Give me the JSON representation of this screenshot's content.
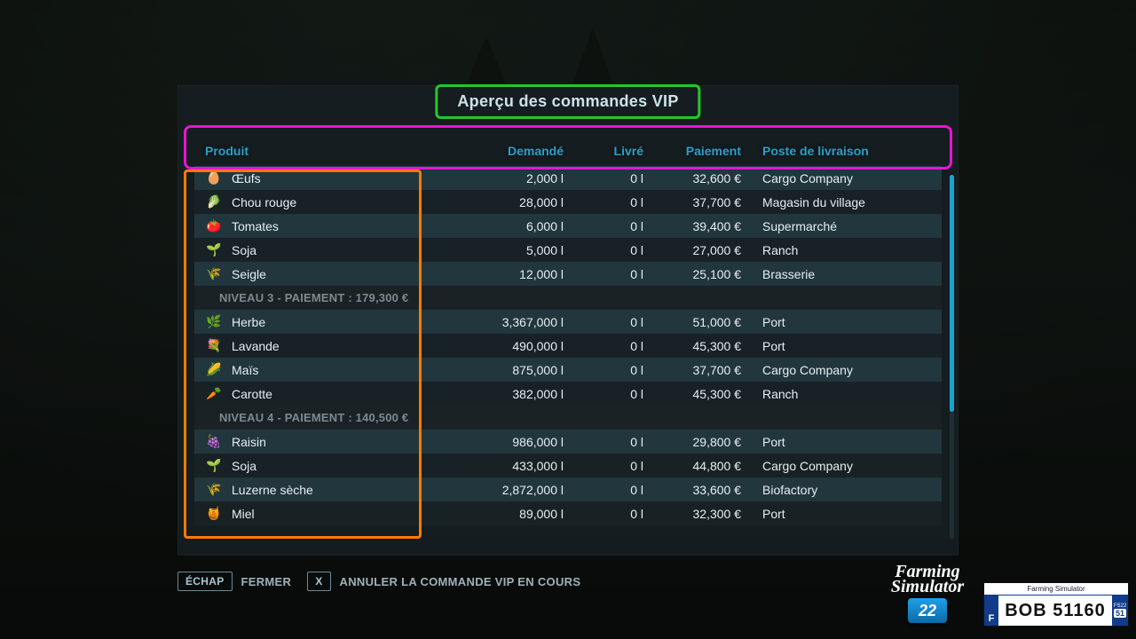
{
  "title": "Aperçu des commandes VIP",
  "columns": {
    "product": "Produit",
    "demand": "Demandé",
    "delivered": "Livré",
    "payment": "Paiement",
    "destination": "Poste de livraison"
  },
  "rows": [
    {
      "type": "item",
      "icon": "🥚",
      "name": "Œufs",
      "demand": "2,000 l",
      "delivered": "0 l",
      "payment": "32,600 €",
      "dest": "Cargo Company"
    },
    {
      "type": "item",
      "icon": "🥬",
      "name": "Chou rouge",
      "demand": "28,000 l",
      "delivered": "0 l",
      "payment": "37,700 €",
      "dest": "Magasin du village"
    },
    {
      "type": "item",
      "icon": "🍅",
      "name": "Tomates",
      "demand": "6,000 l",
      "delivered": "0 l",
      "payment": "39,400 €",
      "dest": "Supermarché"
    },
    {
      "type": "item",
      "icon": "🌱",
      "name": "Soja",
      "demand": "5,000 l",
      "delivered": "0 l",
      "payment": "27,000 €",
      "dest": "Ranch"
    },
    {
      "type": "item",
      "icon": "🌾",
      "name": "Seigle",
      "demand": "12,000 l",
      "delivered": "0 l",
      "payment": "25,100 €",
      "dest": "Brasserie"
    },
    {
      "type": "section",
      "label": "NIVEAU 3 - PAIEMENT : 179,300 €"
    },
    {
      "type": "item",
      "icon": "🌿",
      "name": "Herbe",
      "demand": "3,367,000 l",
      "delivered": "0 l",
      "payment": "51,000 €",
      "dest": "Port"
    },
    {
      "type": "item",
      "icon": "💐",
      "name": "Lavande",
      "demand": "490,000 l",
      "delivered": "0 l",
      "payment": "45,300 €",
      "dest": "Port"
    },
    {
      "type": "item",
      "icon": "🌽",
      "name": "Maïs",
      "demand": "875,000 l",
      "delivered": "0 l",
      "payment": "37,700 €",
      "dest": "Cargo Company"
    },
    {
      "type": "item",
      "icon": "🥕",
      "name": "Carotte",
      "demand": "382,000 l",
      "delivered": "0 l",
      "payment": "45,300 €",
      "dest": "Ranch"
    },
    {
      "type": "section",
      "label": "NIVEAU 4 - PAIEMENT : 140,500 €"
    },
    {
      "type": "item",
      "icon": "🍇",
      "name": "Raisin",
      "demand": "986,000 l",
      "delivered": "0 l",
      "payment": "29,800 €",
      "dest": "Port"
    },
    {
      "type": "item",
      "icon": "🌱",
      "name": "Soja",
      "demand": "433,000 l",
      "delivered": "0 l",
      "payment": "44,800 €",
      "dest": "Cargo Company"
    },
    {
      "type": "item",
      "icon": "🌾",
      "name": "Luzerne sèche",
      "demand": "2,872,000 l",
      "delivered": "0 l",
      "payment": "33,600 €",
      "dest": "Biofactory"
    },
    {
      "type": "item",
      "icon": "🍯",
      "name": "Miel",
      "demand": "89,000 l",
      "delivered": "0 l",
      "payment": "32,300 €",
      "dest": "Port"
    }
  ],
  "footer": {
    "escape_key": "ÉCHAP",
    "close": "FERMER",
    "x_key": "X",
    "cancel": "ANNULER LA COMMANDE VIP EN COURS"
  },
  "branding": {
    "line1": "Farming",
    "line2": "Simulator",
    "year": "22",
    "plate_top_left": "Farming Simulator",
    "plate_country": "F",
    "plate_text": "BOB 51160",
    "plate_region": "51",
    "plate_sub": "FS22"
  }
}
